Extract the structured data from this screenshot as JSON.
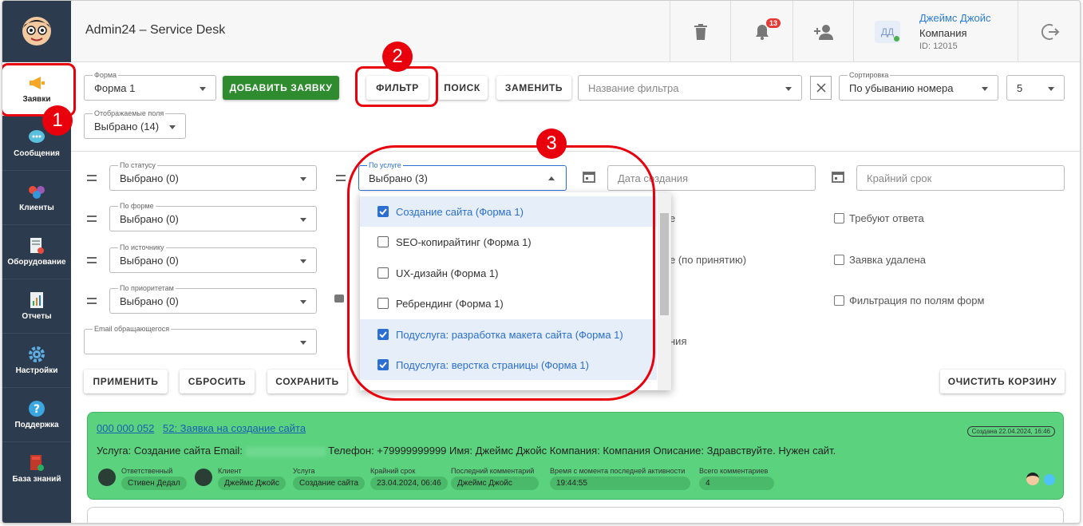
{
  "header": {
    "app_title": "Admin24 – Service Desk",
    "notifications_count": "13",
    "user": {
      "initials": "ДД",
      "name": "Джеймс Джойс",
      "company": "Компания",
      "id": "ID: 12015"
    }
  },
  "sidebar": {
    "items": [
      {
        "label": "Заявки",
        "icon": "megaphone-icon"
      },
      {
        "label": "Сообщения",
        "icon": "chat-icon"
      },
      {
        "label": "Клиенты",
        "icon": "people-icon"
      },
      {
        "label": "Оборудование",
        "icon": "equipment-icon"
      },
      {
        "label": "Отчеты",
        "icon": "report-icon"
      },
      {
        "label": "Настройки",
        "icon": "gear-icon"
      },
      {
        "label": "Поддержка",
        "icon": "help-icon"
      },
      {
        "label": "База знаний",
        "icon": "book-icon"
      }
    ]
  },
  "toolbar": {
    "form": {
      "label": "Форма",
      "value": "Форма 1"
    },
    "add_button": "ДОБАВИТЬ ЗАЯВКУ",
    "filter_button": "ФИЛЬТР",
    "search_button": "ПОИСК",
    "replace_button": "ЗАМЕНИТЬ",
    "filter_name_placeholder": "Название фильтра",
    "sort": {
      "label": "Сортировка",
      "value": "По убыванию номера"
    },
    "page_size": "5",
    "fields": {
      "label": "Отображаемые поля",
      "value": "Выбрано (14)"
    }
  },
  "filters": {
    "status": {
      "label": "По статусу",
      "value": "Выбрано (0)"
    },
    "form": {
      "label": "По форме",
      "value": "Выбрано (0)"
    },
    "source": {
      "label": "По источнику",
      "value": "Выбрано (0)"
    },
    "priority": {
      "label": "По приоритетам",
      "value": "Выбрано (0)"
    },
    "email": {
      "label": "Email обращающегося",
      "value": ""
    },
    "service": {
      "label": "По услуге",
      "value": "Выбрано (3)"
    },
    "created_placeholder": "Дата создания",
    "deadline_placeholder": "Крайний срок",
    "partial_1": "е",
    "partial_2": "е (по принятию)",
    "partial_3": "",
    "partial_4": "ния",
    "check_reply": "Требуют ответа",
    "check_deleted": "Заявка удалена",
    "check_formfields": "Фильтрация по полям форм",
    "apply": "ПРИМЕНИТЬ",
    "reset": "СБРОСИТЬ",
    "save": "СОХРАНИТЬ",
    "clear_trash": "ОЧИСТИТЬ КОРЗИНУ"
  },
  "service_options": [
    {
      "label": "Создание сайта (Форма 1)",
      "checked": true
    },
    {
      "label": "SEO-копирайтинг (Форма 1)",
      "checked": false
    },
    {
      "label": "UX-дизайн (Форма 1)",
      "checked": false
    },
    {
      "label": "Ребрендинг (Форма 1)",
      "checked": false
    },
    {
      "label": "Подуслуга: разработка макета сайта (Форма 1)",
      "checked": true
    },
    {
      "label": "Подуслуга: верстка страницы (Форма 1)",
      "checked": true
    }
  ],
  "annotations": {
    "m1": "1",
    "m2": "2",
    "m3": "3"
  },
  "ticket": {
    "phone_link": "000 000 052",
    "title_link": "52: Заявка на создание сайта",
    "created": "Создана 22.04.2024, 16:46",
    "desc_a": "Услуга: Создание сайта Email:",
    "desc_b": "Телефон: +79999999999 Имя: Джеймс Джойс Компания: Компания Описание: Здравствуйте. Нужен сайт.",
    "meta": [
      {
        "label": "Ответственный",
        "value": "Стивен Дедал"
      },
      {
        "label": "Клиент",
        "value": "Джеймс Джойс"
      },
      {
        "label": "Услуга",
        "value": "Создание сайта"
      },
      {
        "label": "Крайний срок",
        "value": "23.04.2024, 06:46"
      },
      {
        "label": "Последний комментарий",
        "value": "Джеймс Джойс"
      },
      {
        "label": "Время с момента последней активности",
        "value": "19:44:55"
      },
      {
        "label": "Всего комментариев",
        "value": "4"
      }
    ]
  }
}
